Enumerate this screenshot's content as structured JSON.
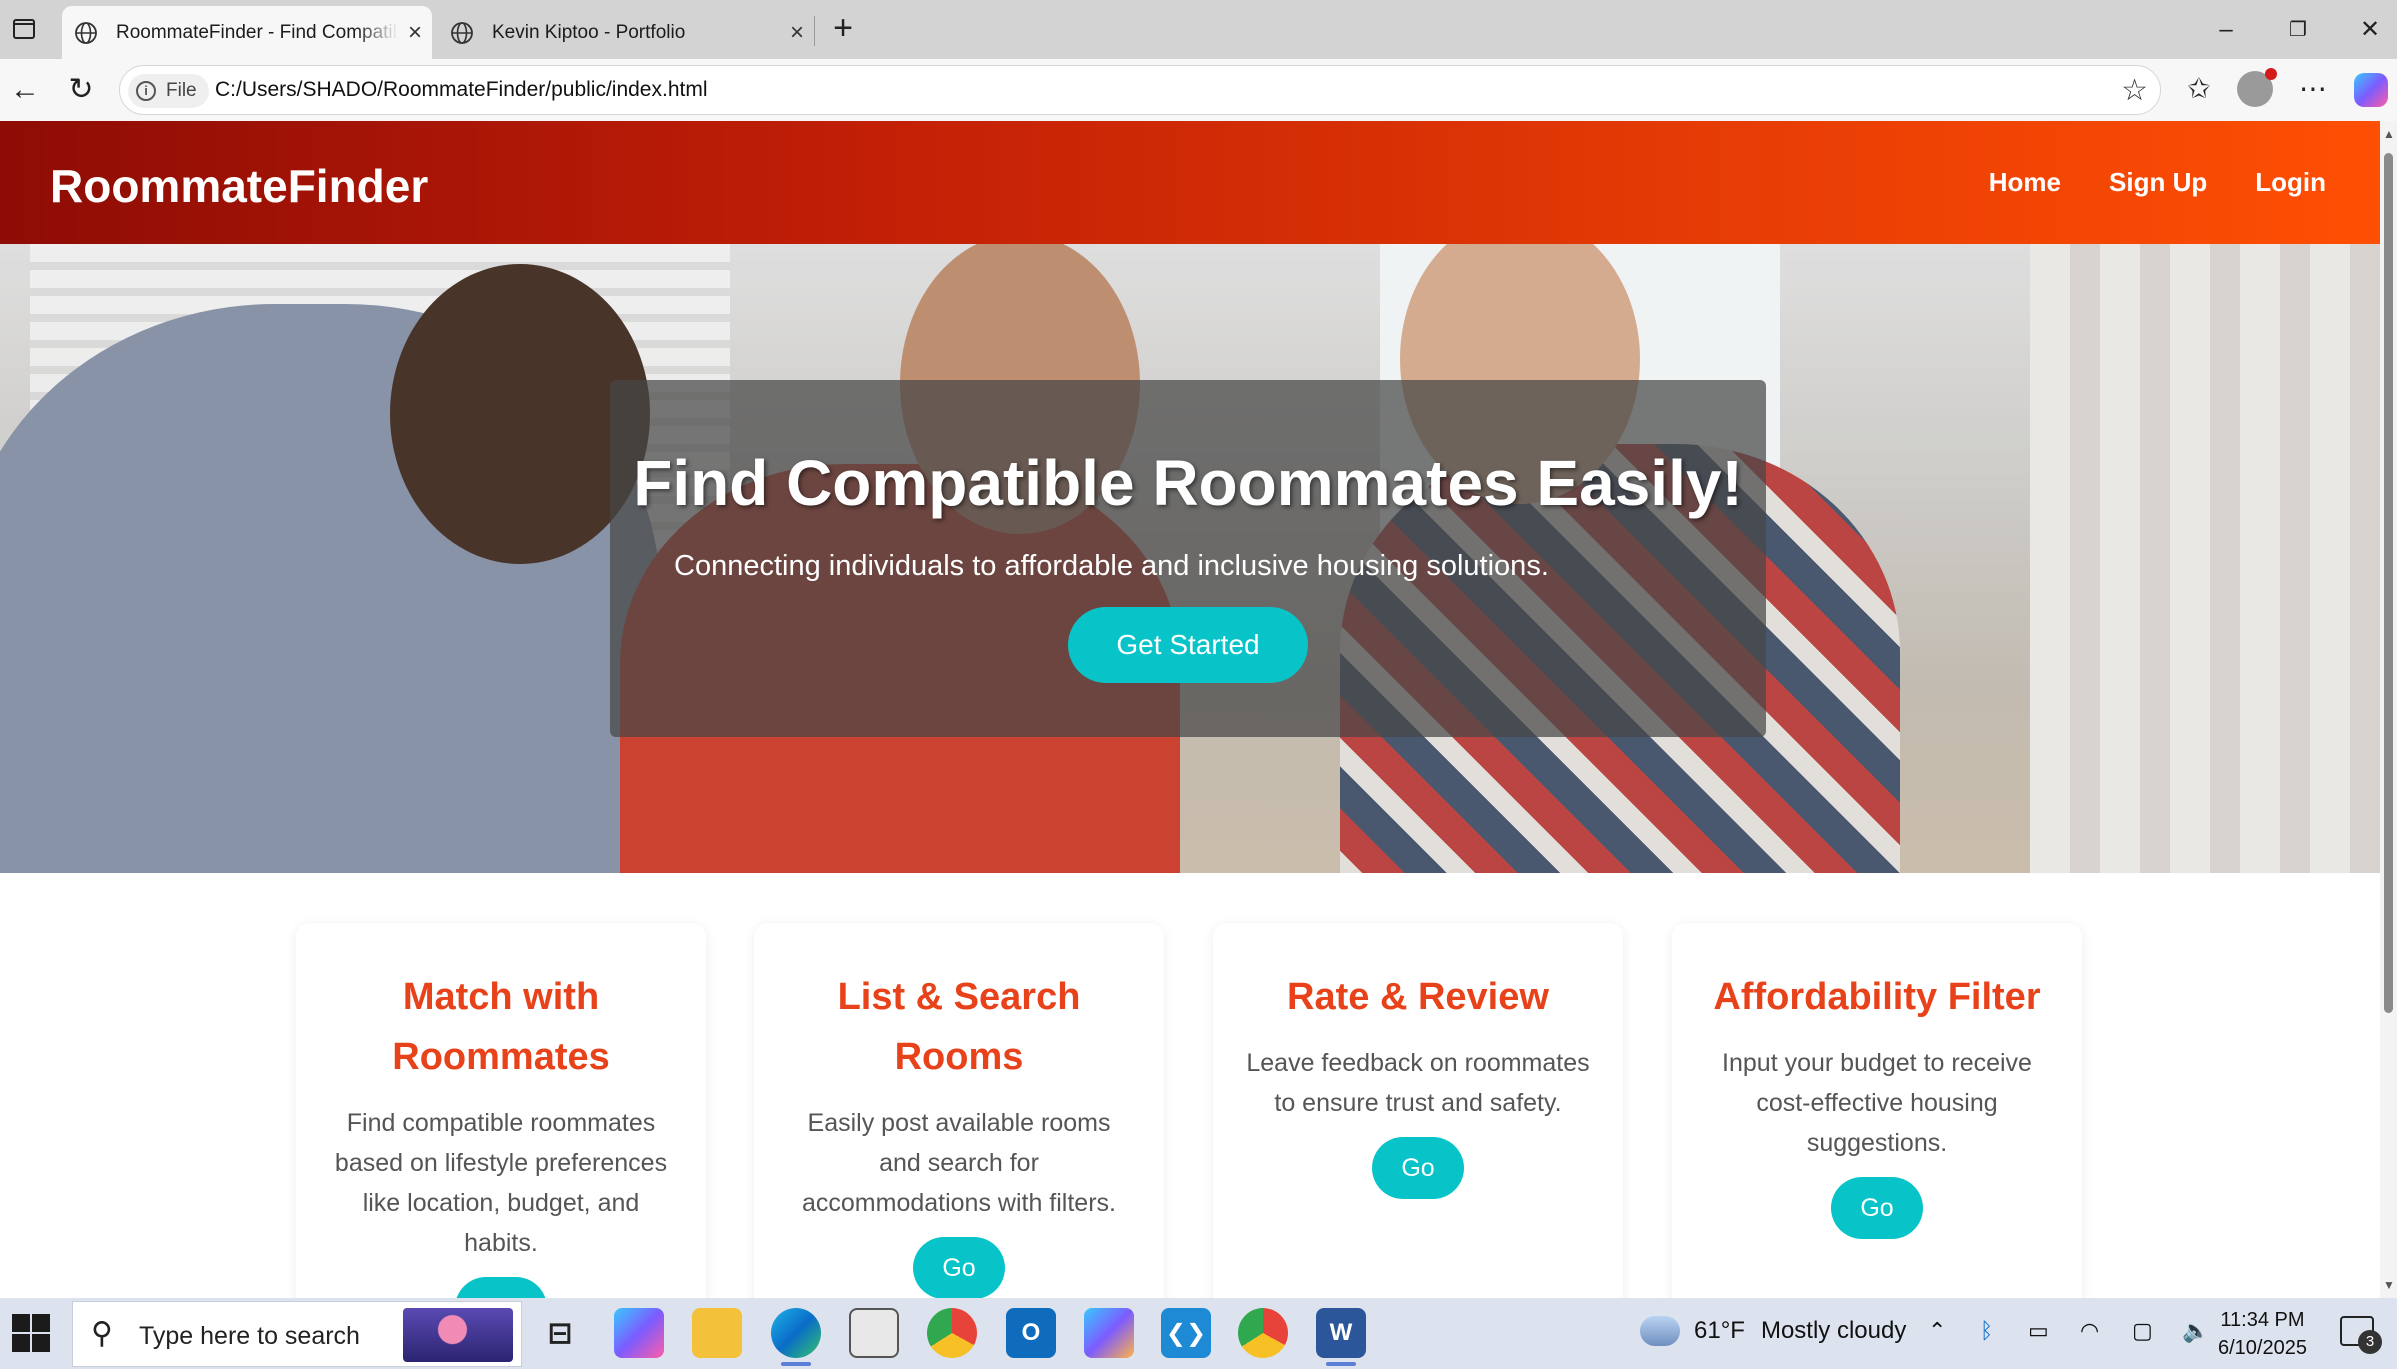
{
  "browser": {
    "tabs": [
      {
        "title": "RoommateFinder - Find Compatible Roommates",
        "active": true
      },
      {
        "title": "Kevin Kiptoo - Portfolio",
        "active": false
      }
    ],
    "address": {
      "scheme_label": "File",
      "url": "C:/Users/SHADO/RoommateFinder/public/index.html"
    }
  },
  "site": {
    "brand": "RoommateFinder",
    "nav": [
      "Home",
      "Sign Up",
      "Login"
    ],
    "hero": {
      "title": "Find Compatible Roommates Easily!",
      "subtitle": "Connecting individuals to affordable and inclusive housing solutions.",
      "cta": "Get Started"
    },
    "features": [
      {
        "title": "Match with Roommates",
        "text": "Find compatible roommates based on lifestyle preferences like location, budget, and habits.",
        "button": "Go"
      },
      {
        "title": "List & Search Rooms",
        "text": "Easily post available rooms and search for accommodations with filters.",
        "button": "Go"
      },
      {
        "title": "Rate & Review",
        "text": "Leave feedback on roommates to ensure trust and safety.",
        "button": "Go"
      },
      {
        "title": "Affordability Filter",
        "text": "Input your budget to receive cost-effective housing suggestions.",
        "button": "Go"
      }
    ],
    "colors": {
      "header_start": "#8e0c05",
      "header_end": "#ff4f04",
      "accent": "#08c4c9",
      "card_title": "#e8421a"
    }
  },
  "taskbar": {
    "search_placeholder": "Type here to search",
    "weather": {
      "temp": "61°F",
      "condition": "Mostly cloudy"
    },
    "time": "11:34 PM",
    "date": "6/10/2025",
    "notifications": "3",
    "apps": [
      "task-view",
      "copilot",
      "file-explorer",
      "edge",
      "store",
      "chrome-profile",
      "outlook",
      "m365",
      "vscode",
      "chrome",
      "word"
    ]
  }
}
